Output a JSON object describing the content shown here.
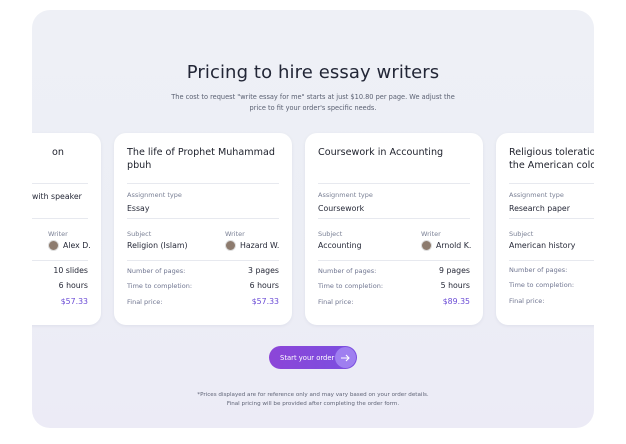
{
  "header": {
    "title": "Pricing to hire essay writers",
    "subtitle": "The cost to request \"write essay for me\" starts at just $10.80 per page. We adjust the price to fit your order's specific needs."
  },
  "labels": {
    "assignment_type": "Assignment type",
    "subject": "Subject",
    "writer": "Writer",
    "pages": "Number of pages:",
    "time": "Time to completion:",
    "price": "Final price:"
  },
  "cards": [
    {
      "title_line1": "on",
      "type": "with speaker",
      "writer": "Alex D.",
      "pages": "10 slides",
      "time": "6 hours",
      "price": "$57.33"
    },
    {
      "title_line1": "The life of Prophet Muhammad",
      "title_line2": "pbuh",
      "type": "Essay",
      "subject": "Religion (Islam)",
      "writer": "Hazard W.",
      "pages": "3 pages",
      "time": "6 hours",
      "price": "$57.33"
    },
    {
      "title_line1": "Coursework in Accounting",
      "type": "Coursework",
      "subject": "Accounting",
      "writer": "Arnold K.",
      "pages": "9 pages",
      "time": "5 hours",
      "price": "$89.35"
    },
    {
      "title_line1": "Religious toleration",
      "title_line2": "the American colo",
      "type": "Research paper",
      "subject": "American history"
    }
  ],
  "cta": {
    "label": "Start your order",
    "icon": "arrow-right-icon"
  },
  "disclaimer": {
    "line1": "*Prices displayed are for reference only and may vary based on your order details.",
    "line2": "Final pricing will be provided after completing the order form."
  },
  "colors": {
    "accent": "#7a4fe0",
    "price": "#6c4dd6",
    "background": "#eef0f6"
  }
}
